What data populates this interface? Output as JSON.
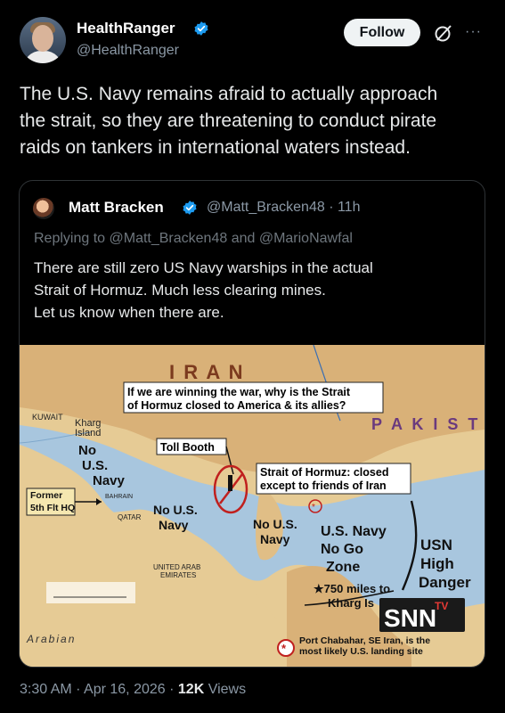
{
  "author": {
    "name": "HealthRanger",
    "handle": "@HealthRanger",
    "follow_label": "Follow"
  },
  "icons": [
    "verified-badge-icon",
    "grok-icon",
    "more-icon"
  ],
  "tweet": {
    "line1": "The U.S. Navy remains afraid to actually approach",
    "line2": "the strait, so they are threatening to conduct pirate",
    "line3": "raids on tankers in international waters instead."
  },
  "quote": {
    "name": "Matt Bracken",
    "handle": "@Matt_Bracken48",
    "time": "11h",
    "replying": "Replying to @Matt_Bracken48 and @MarioNawfal",
    "line1": "There are still zero US Navy warships in the actual",
    "line2": "Strait of Hormuz. Much less clearing mines.",
    "line3": "Let us know when there are."
  },
  "map": {
    "headline_1": "If we are winning the war, why is the Strait",
    "headline_2": "of Hormuz closed to America & its allies?",
    "iran": "I  R  A  N",
    "pakistan": "P A K I S T A",
    "kuwait": "KUWAIT",
    "kharg_1": "Kharg",
    "kharg_2": "Island",
    "no_us_navy_1": "No",
    "no_us_navy_2": "U.S.",
    "no_us_navy_3": "Navy",
    "former_1": "Former",
    "former_2": "5th Flt HQ",
    "bahrain": "BAHRAIN",
    "qatar": "QATAR",
    "toll_booth": "Toll Booth",
    "strait_1": "Strait of Hormuz: closed",
    "strait_2": "except to friends of Iran",
    "no_us_navy_mid_1": "No U.S.",
    "no_us_navy_mid_2": "Navy",
    "no_us_navy_east_1": "No U.S.",
    "no_us_navy_east_2": "Navy",
    "uae_1": "UNITED ARAB",
    "uae_2": "EMIRATES",
    "no_go_1": "U.S. Navy",
    "no_go_2": "No Go",
    "no_go_3": "Zone",
    "miles_1": "★750 miles to",
    "miles_2": "Kharg Is",
    "usn_1": "USN",
    "usn_2": "High",
    "usn_3": "Danger",
    "chabahar_1": "Port Chabahar, SE Iran, is the",
    "chabahar_2": "most likely U.S. landing site",
    "arabian": "Arabian",
    "watermark_1": "SNN",
    "watermark_2": "TV"
  },
  "footer": {
    "time": "3:30 AM · Apr 16, 2026 · ",
    "views_count": "12K",
    "views_label": " Views"
  },
  "colors": {
    "background": "#000000",
    "verified": "#1d9bf0",
    "map_red": "#c0201e",
    "map_water": "#a8c6de",
    "map_land": "#e6cb95"
  }
}
